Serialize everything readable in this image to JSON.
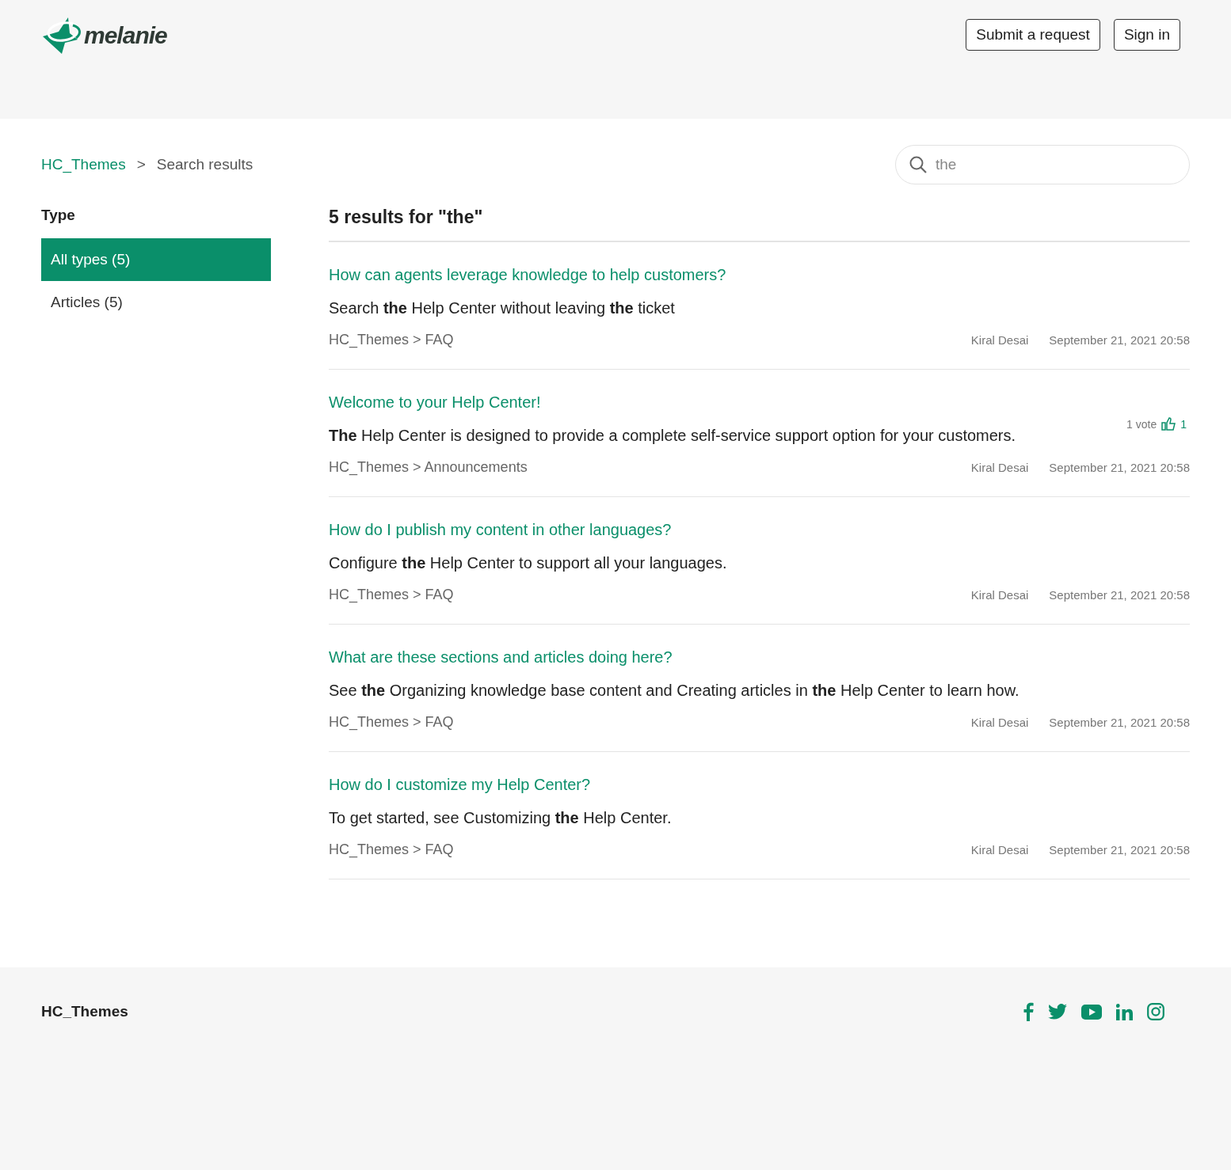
{
  "header": {
    "logo": "melanie",
    "buttons": [
      "Submit a request",
      "Sign in"
    ]
  },
  "breadcrumbs": [
    {
      "label": "HC_Themes",
      "kind": "link"
    },
    {
      "label": ">",
      "kind": "separator"
    },
    {
      "label": "Search results",
      "kind": "current"
    }
  ],
  "search": {
    "value": "the"
  },
  "filter": {
    "title": "Type",
    "items": [
      {
        "label": "All types (5)",
        "selected": true
      },
      {
        "label": "Articles (5)",
        "selected": false
      }
    ]
  },
  "results": {
    "heading": "5 results for \"the\"",
    "items": [
      {
        "title": "How can agents leverage knowledge to help customers?",
        "snippet": "Search **the** Help Center without leaving **the** ticket",
        "path": "HC_Themes > FAQ",
        "author": "Kiral Desai",
        "date": "September 21, 2021 20:58"
      },
      {
        "title": "Welcome to your Help Center!",
        "snippet": "**The** Help Center is designed to provide a complete self-service support option for your customers.",
        "path": "HC_Themes > Announcements",
        "author": "Kiral Desai",
        "date": "September 21, 2021 20:58",
        "votes": {
          "label": "1 vote",
          "count": "1"
        }
      },
      {
        "title": "How do I publish my content in other languages?",
        "snippet": "Configure **the** Help Center to support all your languages.",
        "path": "HC_Themes > FAQ",
        "author": "Kiral Desai",
        "date": "September 21, 2021 20:58"
      },
      {
        "title": "What are these sections and articles doing here?",
        "snippet": "See **the** Organizing knowledge base content and Creating articles in **the** Help Center to learn how.",
        "path": "HC_Themes > FAQ",
        "author": "Kiral Desai",
        "date": "September 21, 2021 20:58"
      },
      {
        "title": "How do I customize my Help Center?",
        "snippet": "To get started, see Customizing **the** Help Center.",
        "path": "HC_Themes > FAQ",
        "author": "Kiral Desai",
        "date": "September 21, 2021 20:58"
      }
    ]
  },
  "footer": {
    "brand": "HC_Themes"
  }
}
